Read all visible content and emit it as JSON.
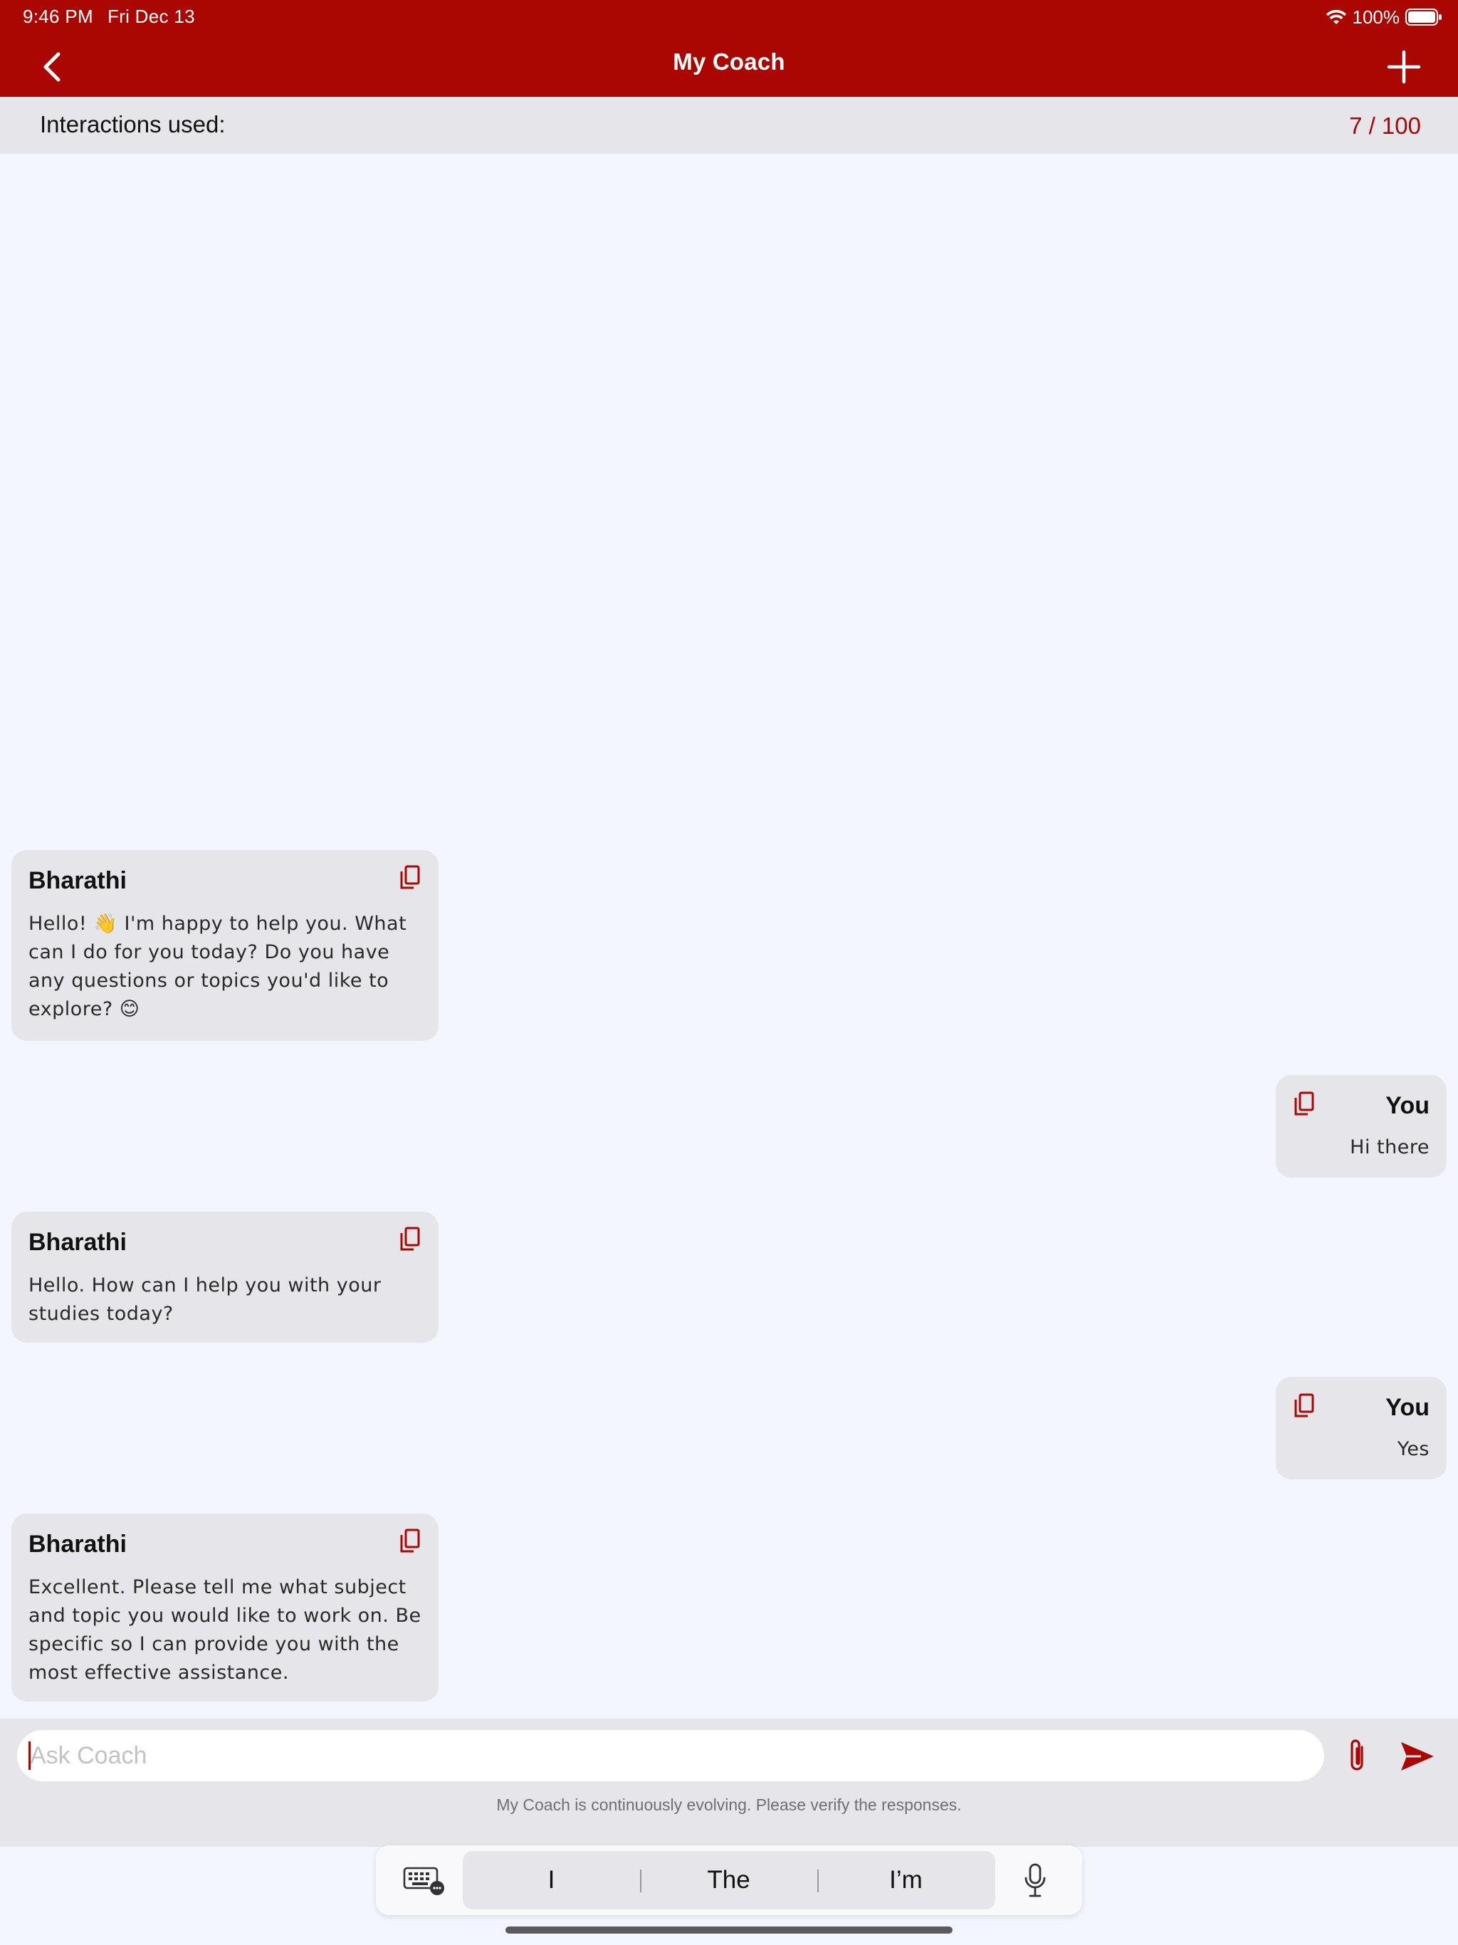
{
  "status_bar": {
    "time": "9:46 PM",
    "date": "Fri Dec 13",
    "battery": "100%",
    "wifi_icon": "wifi-icon",
    "battery_icon": "battery-full-icon"
  },
  "nav": {
    "title": "My Coach",
    "back_icon": "chevron-left-icon",
    "new_icon": "plus-icon"
  },
  "interactions": {
    "label": "Interactions used:",
    "count": "7 / 100",
    "used": 7,
    "limit": 100
  },
  "messages": [
    {
      "sender": "Bharathi",
      "role": "coach",
      "text": "Hello! 👋 I'm happy to help you. What can I do for you today? Do you have any questions or topics you'd like to explore? 😊"
    },
    {
      "sender": "You",
      "role": "user",
      "text": "Hi there"
    },
    {
      "sender": "Bharathi",
      "role": "coach",
      "text": "Hello.  How can I help you with your studies today?"
    },
    {
      "sender": "You",
      "role": "user",
      "text": "Yes"
    },
    {
      "sender": "Bharathi",
      "role": "coach",
      "text": "Excellent. Please tell me what subject and topic you would like to work on.  Be specific so I can provide you with the most effective assistance."
    }
  ],
  "composer": {
    "placeholder": "Ask Coach",
    "value": "",
    "disclaimer": "My Coach is continuously evolving. Please verify the responses.",
    "attach_icon": "paperclip-icon",
    "send_icon": "send-icon"
  },
  "keyboard_bar": {
    "suggestions": [
      "I",
      "The",
      "I’m"
    ],
    "keyboard_icon": "keyboard-icon",
    "mic_icon": "microphone-icon"
  },
  "colors": {
    "brand": "#ab0702",
    "background": "#f3f6fd",
    "bubble": "#e6e6ea",
    "bar": "#e6e6ea"
  }
}
